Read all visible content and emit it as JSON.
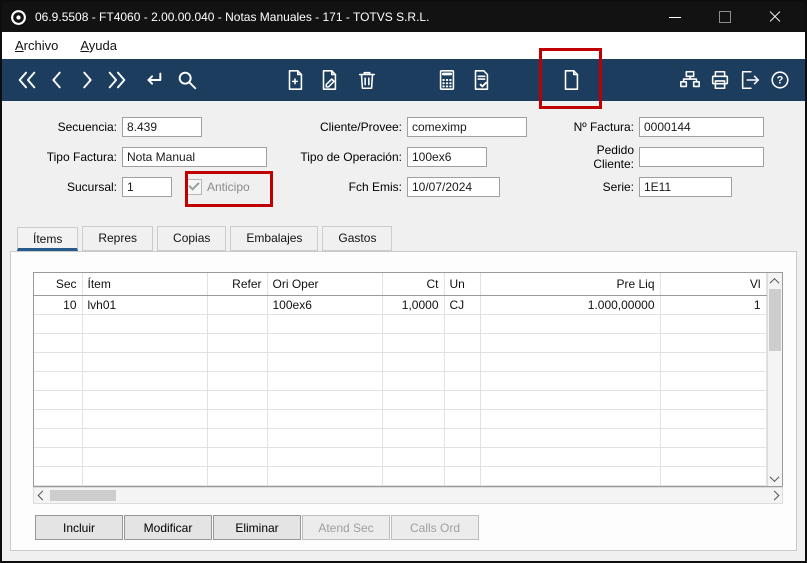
{
  "colors": {
    "titlebar": "#121212",
    "toolbar": "#1d3d5f",
    "highlight": "#c00000",
    "tab_active_underline": "#27598a"
  },
  "window": {
    "title": "06.9.5508 - FT4060 - 2.00.00.040 - Notas Manuales - 171 - TOTVS S.R.L.",
    "controls": [
      "minimize",
      "maximize",
      "close"
    ]
  },
  "menu": {
    "items": [
      {
        "label": "Archivo"
      },
      {
        "label": "Ayuda"
      }
    ]
  },
  "toolbar": {
    "help_glyph": "?",
    "icons": [
      "go-first",
      "go-previous",
      "go-next",
      "go-last",
      "enter-query",
      "search",
      "new-document",
      "edit-document",
      "delete",
      "calculator",
      "document-check",
      "blank-document",
      "program-tree",
      "print",
      "exit",
      "help"
    ],
    "highlighted_icon": "blank-document"
  },
  "form": {
    "secuencia": {
      "label": "Secuencia:",
      "value": "8.439"
    },
    "cliente": {
      "label": "Cliente/Provee:",
      "value": "comeximp"
    },
    "factura": {
      "label": "Nº Factura:",
      "value": "0000144"
    },
    "tipo_factura": {
      "label": "Tipo Factura:",
      "value": "Nota Manual"
    },
    "tipo_operacion": {
      "label": "Tipo de Operación:",
      "value": "100ex6"
    },
    "pedido": {
      "label": "Pedido Cliente:",
      "value": ""
    },
    "sucursal": {
      "label": "Sucursal:",
      "value": "1"
    },
    "anticipo": {
      "label": "Anticipo",
      "checked": true,
      "enabled": false
    },
    "fch_emis": {
      "label": "Fch Emis:",
      "value": "10/07/2024"
    },
    "serie": {
      "label": "Serie:",
      "value": "1E11"
    }
  },
  "tabs": {
    "items": [
      "Ítems",
      "Repres",
      "Copias",
      "Embalajes",
      "Gastos"
    ],
    "active": "Ítems"
  },
  "grid": {
    "columns": [
      {
        "label": "Sec",
        "align": "right"
      },
      {
        "label": "Ítem",
        "align": "left"
      },
      {
        "label": "Refer",
        "align": "right"
      },
      {
        "label": "Ori Oper",
        "align": "left"
      },
      {
        "label": "Ct",
        "align": "right"
      },
      {
        "label": "Un",
        "align": "left"
      },
      {
        "label": "Pre Liq",
        "align": "right"
      },
      {
        "label": "Vl",
        "align": "right"
      }
    ],
    "rows": [
      {
        "cells": [
          "10",
          "lvh01",
          "",
          "100ex6",
          "1,0000",
          "CJ",
          "1.000,00000",
          "1"
        ]
      }
    ]
  },
  "actions": [
    {
      "label": "Incluir",
      "enabled": true
    },
    {
      "label": "Modificar",
      "enabled": true
    },
    {
      "label": "Eliminar",
      "enabled": true
    },
    {
      "label": "Atend Sec",
      "enabled": false
    },
    {
      "label": "Calls Ord",
      "enabled": false
    }
  ]
}
